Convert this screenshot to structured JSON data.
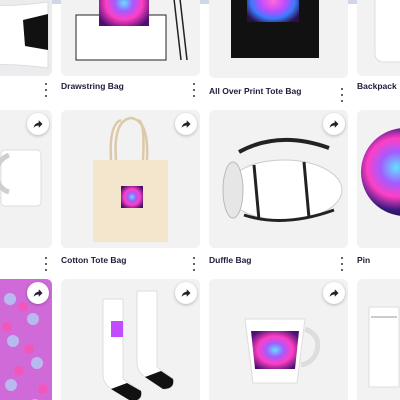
{
  "products": [
    {
      "id": "partial-left-top",
      "label": "",
      "menu": true
    },
    {
      "id": "drawstring",
      "label": "Drawstring Bag",
      "menu": true
    },
    {
      "id": "allover-tote",
      "label": "All Over Print Tote Bag",
      "menu": true
    },
    {
      "id": "backpack",
      "label": "Backpack",
      "menu": false
    },
    {
      "id": "mug-partial",
      "label": "",
      "menu": true
    },
    {
      "id": "cotton-tote",
      "label": "Cotton Tote Bag",
      "menu": true
    },
    {
      "id": "duffle",
      "label": "Duffle Bag",
      "menu": true
    },
    {
      "id": "pin",
      "label": "Pin",
      "menu": false
    },
    {
      "id": "pattern-partial",
      "label": "",
      "menu": false
    },
    {
      "id": "socks",
      "label": "",
      "menu": false
    },
    {
      "id": "latte-mug",
      "label": "",
      "menu": false
    },
    {
      "id": "pouch",
      "label": "",
      "menu": false
    }
  ],
  "icons": {
    "share": "share-arrow-icon",
    "more": "more-vertical-icon"
  },
  "colors": {
    "tile_bg": "#f2f2f3",
    "label_text": "#1d1c39"
  }
}
